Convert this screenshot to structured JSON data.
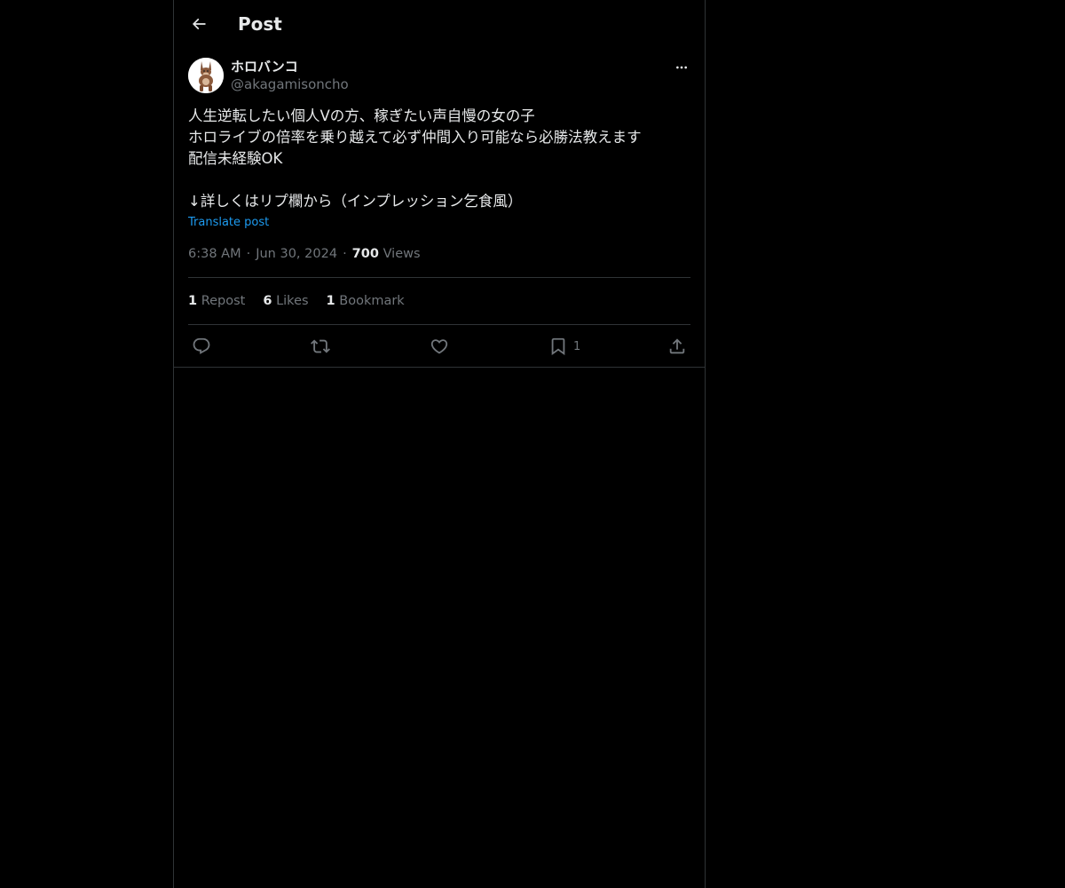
{
  "header": {
    "back_icon": "arrow-left-icon",
    "title": "Post"
  },
  "author": {
    "display_name": "ホロバンコ",
    "handle": "@akagamisoncho",
    "avatar_icon": "donkey-avatar"
  },
  "post": {
    "text": "人生逆転したい個人Vの方、稼ぎたい声自慢の女の子\nホロライブの倍率を乗り越えて必ず仲間入り可能なら必勝法教えます\n配信未経験OK\n\n↓詳しくはリプ欄から（インプレッション乞食風）",
    "translate_label": "Translate post",
    "time": "6:38 AM",
    "date": "Jun 30, 2024",
    "views_count": "700",
    "views_label": "Views"
  },
  "stats": {
    "reposts_count": "1",
    "reposts_label": "Repost",
    "likes_count": "6",
    "likes_label": "Likes",
    "bookmarks_count": "1",
    "bookmarks_label": "Bookmark"
  },
  "actions": {
    "reply_icon": "reply-icon",
    "repost_icon": "repost-icon",
    "like_icon": "heart-icon",
    "bookmark_icon": "bookmark-icon",
    "bookmark_count": "1",
    "share_icon": "share-icon"
  },
  "colors": {
    "background": "#000000",
    "text": "#e7e9ea",
    "secondary": "#71767b",
    "link": "#1d9bf0",
    "border": "#2f3336"
  }
}
